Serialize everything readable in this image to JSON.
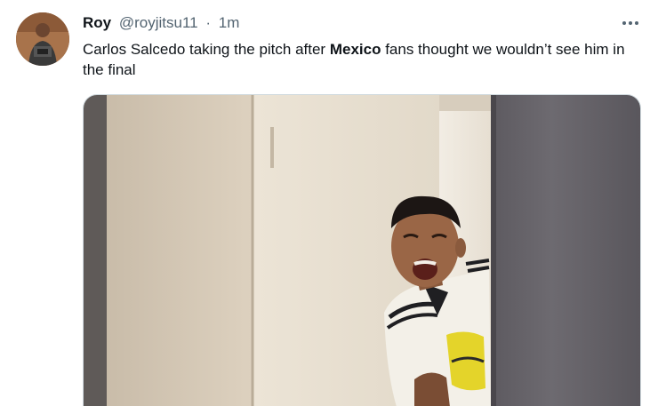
{
  "tweet": {
    "display_name": "Roy",
    "handle": "@royjitsu11",
    "separator": "·",
    "timestamp": "1m",
    "text_part1": "Carlos Salcedo taking the pitch after ",
    "text_bold": "Mexico",
    "text_part2": " fans thought we wouldn’t see him in the final",
    "more_icon": "more-horizontal-icon",
    "avatar_icon": "profile-avatar",
    "media_type": "photo"
  },
  "colors": {
    "text_primary": "#0f1419",
    "text_secondary": "#536471",
    "media_border": "#cfd9de"
  }
}
